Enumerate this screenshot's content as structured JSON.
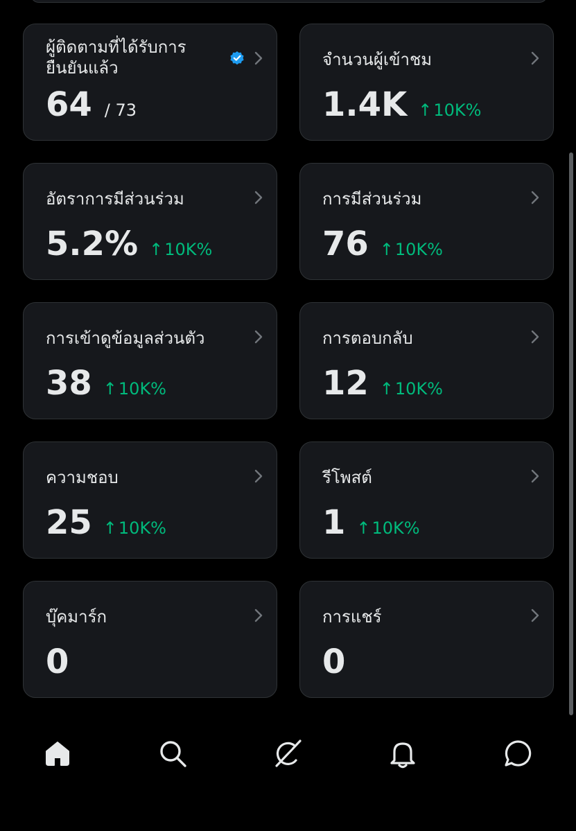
{
  "colors": {
    "background": "#000000",
    "card": "#16181c",
    "card_border": "#2f3336",
    "text": "#e7e9ea",
    "positive": "#00ba7c",
    "verified": "#1d9bf0"
  },
  "cards": [
    {
      "title": "ผู้ติดตามที่ได้รับการยืนยันแล้ว",
      "value": "64",
      "total": "/ 73",
      "verified_icon": "verified-badge-icon"
    },
    {
      "title": "จำนวนผู้เข้าชม",
      "value": "1.4K",
      "change": "10K%"
    },
    {
      "title": "อัตราการมีส่วนร่วม",
      "value": "5.2%",
      "change": "10K%"
    },
    {
      "title": "การมีส่วนร่วม",
      "value": "76",
      "change": "10K%"
    },
    {
      "title": "การเข้าดูข้อมูลส่วนตัว",
      "value": "38",
      "change": "10K%"
    },
    {
      "title": "การตอบกลับ",
      "value": "12",
      "change": "10K%"
    },
    {
      "title": "ความชอบ",
      "value": "25",
      "change": "10K%"
    },
    {
      "title": "รีโพสต์",
      "value": "1",
      "change": "10K%"
    },
    {
      "title": "บุ๊คมาร์ก",
      "value": "0"
    },
    {
      "title": "การแชร์",
      "value": "0"
    }
  ],
  "change_arrow": "↑",
  "tabbar": {
    "items": [
      "home-icon",
      "search-icon",
      "grok-icon",
      "notifications-icon",
      "messages-icon"
    ]
  }
}
